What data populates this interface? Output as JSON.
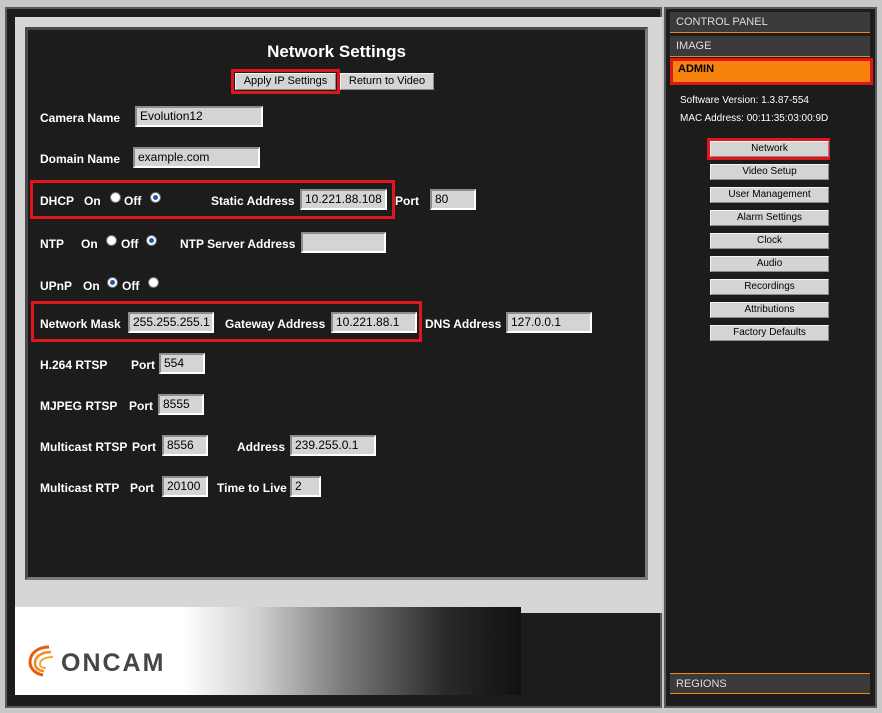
{
  "title": "Network Settings",
  "buttons": {
    "apply": "Apply IP Settings",
    "return": "Return to Video"
  },
  "camera_name": {
    "label": "Camera Name",
    "value": "Evolution12"
  },
  "domain_name": {
    "label": "Domain Name",
    "value": "example.com"
  },
  "dhcp": {
    "label": "DHCP",
    "on": "On",
    "off": "Off",
    "selected": "off",
    "static_label": "Static Address",
    "static_value": "10.221.88.108",
    "port_label": "Port",
    "port_value": "80"
  },
  "ntp": {
    "label": "NTP",
    "on": "On",
    "off": "Off",
    "selected": "off",
    "server_label": "NTP Server Address",
    "server_value": ""
  },
  "upnp": {
    "label": "UPnP",
    "on": "On",
    "off": "Off",
    "selected": "on"
  },
  "network_mask": {
    "label": "Network Mask",
    "value": "255.255.255.1"
  },
  "gateway": {
    "label": "Gateway Address",
    "value": "10.221.88.1"
  },
  "dns": {
    "label": "DNS Address",
    "value": "127.0.0.1"
  },
  "h264": {
    "label": "H.264 RTSP",
    "port_label": "Port",
    "port_value": "554"
  },
  "mjpeg": {
    "label": "MJPEG RTSP",
    "port_label": "Port",
    "port_value": "8555"
  },
  "multicast_rtsp": {
    "label": "Multicast RTSP",
    "port_label": "Port",
    "port_value": "8556",
    "address_label": "Address",
    "address_value": "239.255.0.1"
  },
  "multicast_rtp": {
    "label": "Multicast RTP",
    "port_label": "Port",
    "port_value": "20100",
    "ttl_label": "Time to Live",
    "ttl_value": "2"
  },
  "logo": {
    "text": "ONCAM"
  },
  "sidebar": {
    "control_panel": "CONTROL PANEL",
    "image": "IMAGE",
    "admin": "ADMIN",
    "regions": "REGIONS",
    "software_version": "Software Version:  1.3.87-554",
    "mac_address": "MAC Address:  00:11:35:03:00:9D",
    "items": [
      "Network",
      "Video Setup",
      "User Management",
      "Alarm Settings",
      "Clock",
      "Audio",
      "Recordings",
      "Attributions",
      "Factory Defaults"
    ]
  },
  "colors": {
    "accent": "#f5830e",
    "highlight": "#e0161c",
    "panel": "#1c1c1c"
  }
}
